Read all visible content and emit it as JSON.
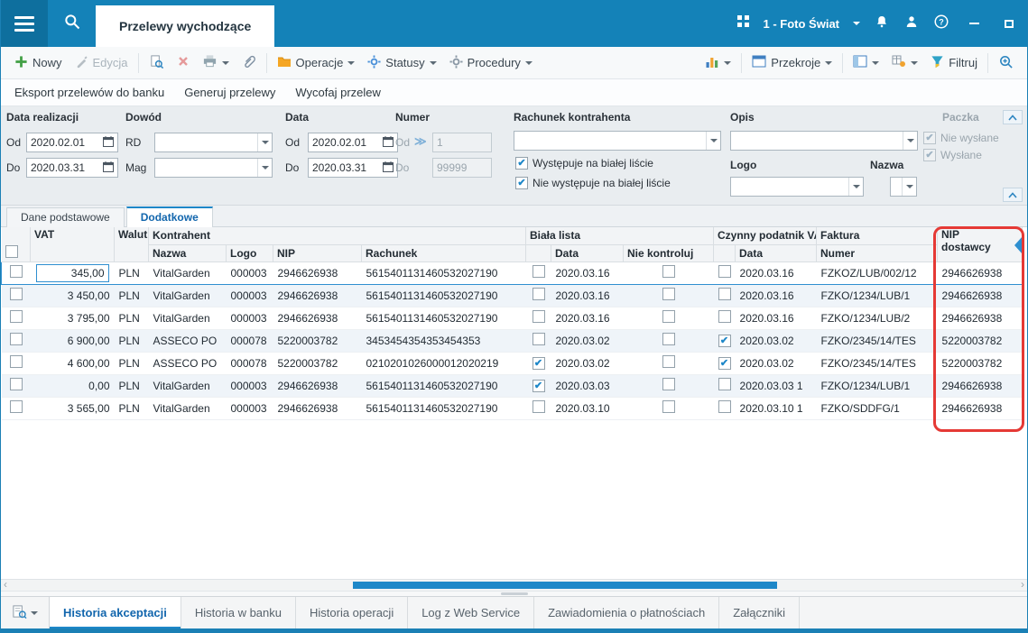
{
  "titlebar": {
    "tab": "Przelewy wychodzące",
    "company": "1 - Foto Świat"
  },
  "ribbon": {
    "nowy": "Nowy",
    "edycja": "Edycja",
    "operacje": "Operacje",
    "statusy": "Statusy",
    "procedury": "Procedury",
    "przekroje": "Przekroje",
    "filtruj": "Filtruj"
  },
  "actions": {
    "eksport": "Eksport przelewów do banku",
    "generuj": "Generuj przelewy",
    "wycofaj": "Wycofaj przelew"
  },
  "filters": {
    "data_realizacji": {
      "label": "Data realizacji",
      "od_label": "Od",
      "do_label": "Do",
      "od": "2020.02.01",
      "do": "2020.03.31"
    },
    "dowod": {
      "label": "Dowód",
      "rd_label": "RD",
      "mag_label": "Mag",
      "rd": "",
      "mag": ""
    },
    "data": {
      "label": "Data",
      "od_label": "Od",
      "do_label": "Do",
      "od": "2020.02.01",
      "do": "2020.03.31"
    },
    "numer": {
      "label": "Numer",
      "od_label": "Od",
      "do_label": "Do",
      "od": "1",
      "do": "99999"
    },
    "rachunek": {
      "label": "Rachunek kontrahenta",
      "value": "",
      "cb1": "Występuje na białej liście",
      "cb1_checked": true,
      "cb2": "Nie występuje na białej liście",
      "cb2_checked": true
    },
    "opis": {
      "label": "Opis",
      "value": ""
    },
    "logo": {
      "label": "Logo",
      "value": ""
    },
    "nazwa": {
      "label": "Nazwa"
    },
    "paczka": {
      "label": "Paczka",
      "cb1": "Nie wysłane",
      "cb1_checked": true,
      "cb2": "Wysłane",
      "cb2_checked": true
    }
  },
  "tabs": {
    "items": [
      {
        "label": "Dane podstawowe",
        "active": false
      },
      {
        "label": "Dodatkowe",
        "active": true
      }
    ]
  },
  "grid": {
    "groups": {
      "kontrahent": "Kontrahent",
      "biala_lista": "Biała lista",
      "czynny": "Czynny podatnik VA",
      "faktura": "Faktura"
    },
    "columns": {
      "vat": "VAT",
      "walut": "Walut",
      "nazwa": "Nazwa",
      "logo": "Logo",
      "nip": "NIP",
      "rachunek": "Rachunek",
      "bl_data": "Data",
      "nie_kontroluj": "Nie kontroluj",
      "cz_data": "Data",
      "numer": "Numer",
      "nip_d1": "NIP",
      "nip_d2": "dostawcy"
    },
    "rows": [
      {
        "vat": "345,00",
        "walut": "PLN",
        "nazwa": "VitalGarden",
        "logo": "000003",
        "nip": "2946626938",
        "rachunek": "5615401131460532027190",
        "bl_check": false,
        "bl_data": "2020.03.16",
        "nie_kontroluj": false,
        "cz_check": false,
        "cz_data": "2020.03.16",
        "numer": "FZKOZ/LUB/002/12",
        "nip_dostawcy": "2946626938",
        "selected": true,
        "editing": true
      },
      {
        "vat": "3 450,00",
        "walut": "PLN",
        "nazwa": "VitalGarden",
        "logo": "000003",
        "nip": "2946626938",
        "rachunek": "5615401131460532027190",
        "bl_check": false,
        "bl_data": "2020.03.16",
        "nie_kontroluj": false,
        "cz_check": false,
        "cz_data": "2020.03.16",
        "numer": "FZKO/1234/LUB/1",
        "nip_dostawcy": "2946626938"
      },
      {
        "vat": "3 795,00",
        "walut": "PLN",
        "nazwa": "VitalGarden",
        "logo": "000003",
        "nip": "2946626938",
        "rachunek": "5615401131460532027190",
        "bl_check": false,
        "bl_data": "2020.03.16",
        "nie_kontroluj": false,
        "cz_check": false,
        "cz_data": "2020.03.16",
        "numer": "FZKO/1234/LUB/2",
        "nip_dostawcy": "2946626938"
      },
      {
        "vat": "6 900,00",
        "walut": "PLN",
        "nazwa": "ASSECO PO",
        "logo": "000078",
        "nip": "5220003782",
        "rachunek": "3453454354353454353",
        "bl_check": false,
        "bl_data": "2020.03.02",
        "nie_kontroluj": false,
        "cz_check": true,
        "cz_data": "2020.03.02",
        "numer": "FZKO/2345/14/TES",
        "nip_dostawcy": "5220003782"
      },
      {
        "vat": "4 600,00",
        "walut": "PLN",
        "nazwa": "ASSECO PO",
        "logo": "000078",
        "nip": "5220003782",
        "rachunek": "0210201026000012020219",
        "bl_check": true,
        "bl_data": "2020.03.02",
        "nie_kontroluj": false,
        "cz_check": true,
        "cz_data": "2020.03.02",
        "numer": "FZKO/2345/14/TES",
        "nip_dostawcy": "5220003782"
      },
      {
        "vat": "0,00",
        "walut": "PLN",
        "nazwa": "VitalGarden",
        "logo": "000003",
        "nip": "2946626938",
        "rachunek": "5615401131460532027190",
        "bl_check": true,
        "bl_data": "2020.03.03",
        "nie_kontroluj": false,
        "cz_check": false,
        "cz_data": "2020.03.03 1",
        "numer": "FZKO/1234/LUB/1",
        "nip_dostawcy": "2946626938"
      },
      {
        "vat": "3 565,00",
        "walut": "PLN",
        "nazwa": "VitalGarden",
        "logo": "000003",
        "nip": "2946626938",
        "rachunek": "5615401131460532027190",
        "bl_check": false,
        "bl_data": "2020.03.10",
        "nie_kontroluj": false,
        "cz_check": false,
        "cz_data": "2020.03.10 1",
        "numer": "FZKO/SDDFG/1",
        "nip_dostawcy": "2946626938"
      }
    ]
  },
  "bottom_tabs": {
    "items": [
      {
        "label": "Historia akceptacji",
        "active": true
      },
      {
        "label": "Historia w banku",
        "active": false
      },
      {
        "label": "Historia operacji",
        "active": false
      },
      {
        "label": "Log z Web Service",
        "active": false
      },
      {
        "label": "Zawiadomienia o płatnościach",
        "active": false
      },
      {
        "label": "Załączniki",
        "active": false
      }
    ]
  },
  "annotation": {
    "type": "highlight-box",
    "target": "NIP dostawcy column",
    "color": "#e53935"
  }
}
